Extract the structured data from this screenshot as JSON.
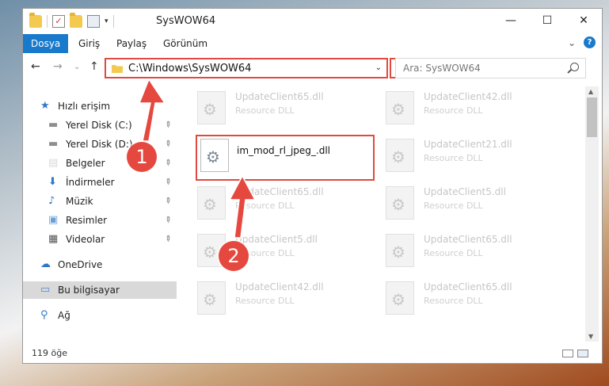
{
  "window": {
    "title": "SysWOW64",
    "controls": {
      "minimize": "—",
      "maximize": "☐",
      "close": "✕"
    }
  },
  "ribbon": {
    "tabs": [
      {
        "label": "Dosya",
        "active": true
      },
      {
        "label": "Giriş",
        "active": false
      },
      {
        "label": "Paylaş",
        "active": false
      },
      {
        "label": "Görünüm",
        "active": false
      }
    ],
    "expand": "⌄",
    "help": "?"
  },
  "navbar": {
    "back": "←",
    "forward": "→",
    "recent": "⌄",
    "up": "↑",
    "address": "C:\\Windows\\SysWOW64",
    "address_chevron": "⌄",
    "refresh": "↻",
    "search_placeholder": "Ara: SysWOW64"
  },
  "sidebar": {
    "items": [
      {
        "label": "Hızlı erişim",
        "icon": "star-icon",
        "pinned": false
      },
      {
        "label": "Yerel Disk (C:)",
        "icon": "drive-icon",
        "pinned": true
      },
      {
        "label": "Yerel Disk (D:)",
        "icon": "drive-icon",
        "pinned": true
      },
      {
        "label": "Belgeler",
        "icon": "document-icon",
        "pinned": true
      },
      {
        "label": "İndirmeler",
        "icon": "download-icon",
        "pinned": true
      },
      {
        "label": "Müzik",
        "icon": "music-icon",
        "pinned": true
      },
      {
        "label": "Resimler",
        "icon": "picture-icon",
        "pinned": true
      },
      {
        "label": "Videolar",
        "icon": "video-icon",
        "pinned": true
      },
      {
        "label": "OneDrive",
        "icon": "cloud-icon",
        "pinned": false
      },
      {
        "label": "Bu bilgisayar",
        "icon": "computer-icon",
        "pinned": false,
        "selected": true
      },
      {
        "label": "Ağ",
        "icon": "network-icon",
        "pinned": false
      }
    ],
    "pin_glyph": "📌"
  },
  "files": {
    "highlighted": {
      "name": "im_mod_rl_jpeg_.dll"
    },
    "items": [
      {
        "name": "UpdateClient65.dll",
        "type": "Resource DLL"
      },
      {
        "name": "UpdateClient42.dll",
        "type": "Resource DLL"
      },
      {
        "name": "UpdateClient21.dll",
        "type": "Resource DLL"
      },
      {
        "name": "UpdateClient65.dll",
        "type": "Resource DLL"
      },
      {
        "name": "UpdateClient5.dll",
        "type": "Resource DLL"
      },
      {
        "name": "UpdateClient5.dll",
        "type": "Resource DLL"
      },
      {
        "name": "UpdateClient65.dll",
        "type": "Resource DLL"
      },
      {
        "name": "UpdateClient42.dll",
        "type": "Resource DLL"
      },
      {
        "name": "UpdateClient65.dll",
        "type": "Resource DLL"
      }
    ]
  },
  "status": {
    "count": "119 öğe"
  },
  "annotations": {
    "step1": "1",
    "step2": "2"
  },
  "colors": {
    "accent": "#1979ca",
    "highlight": "#e04a3f",
    "callout": "#e5483f"
  }
}
